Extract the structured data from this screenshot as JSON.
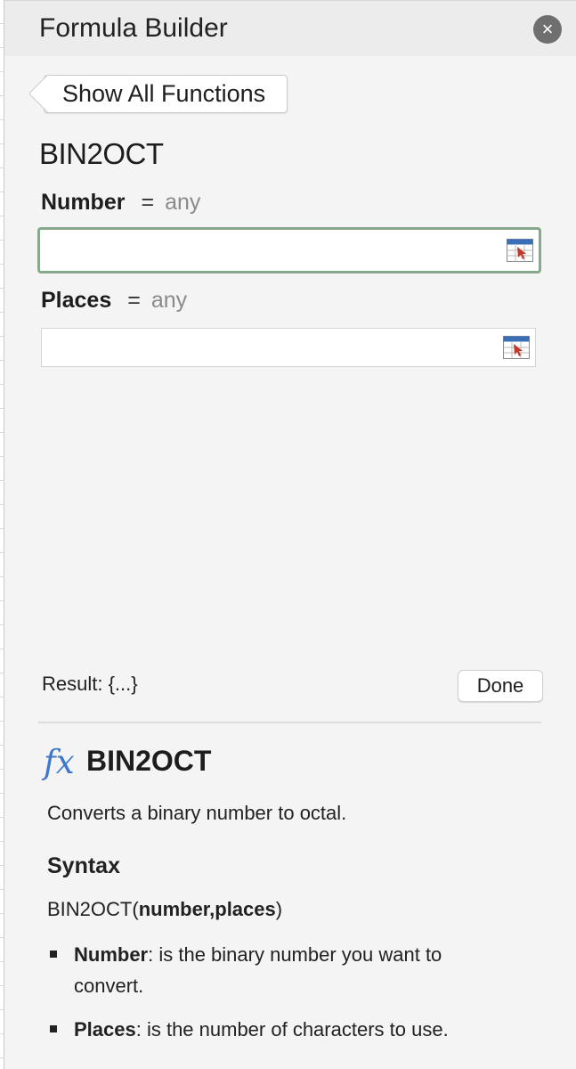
{
  "header": {
    "title": "Formula Builder",
    "close_glyph": "×"
  },
  "back_button": {
    "label": "Show All Functions"
  },
  "function": {
    "name": "BIN2OCT"
  },
  "arguments": [
    {
      "name": "Number",
      "equals": "=",
      "type": "any",
      "value": ""
    },
    {
      "name": "Places",
      "equals": "=",
      "type": "any",
      "value": ""
    }
  ],
  "result": {
    "text": "Result: {...}"
  },
  "done_button": {
    "label": "Done"
  },
  "help": {
    "icon": "fx",
    "title": "BIN2OCT",
    "description": "Converts a binary number to octal.",
    "syntax_heading": "Syntax",
    "syntax": {
      "prefix": "BIN2OCT(",
      "args": "number,places",
      "suffix": ")"
    },
    "bullets": [
      {
        "term": "Number",
        "text": ": is the binary number you want to convert."
      },
      {
        "term": "Places",
        "text": ": is the number of characters to use."
      }
    ]
  },
  "colors": {
    "focus_border": "#86a98c",
    "fx_icon": "#3f78c9",
    "ref_icon_arrow": "#c0392b"
  }
}
